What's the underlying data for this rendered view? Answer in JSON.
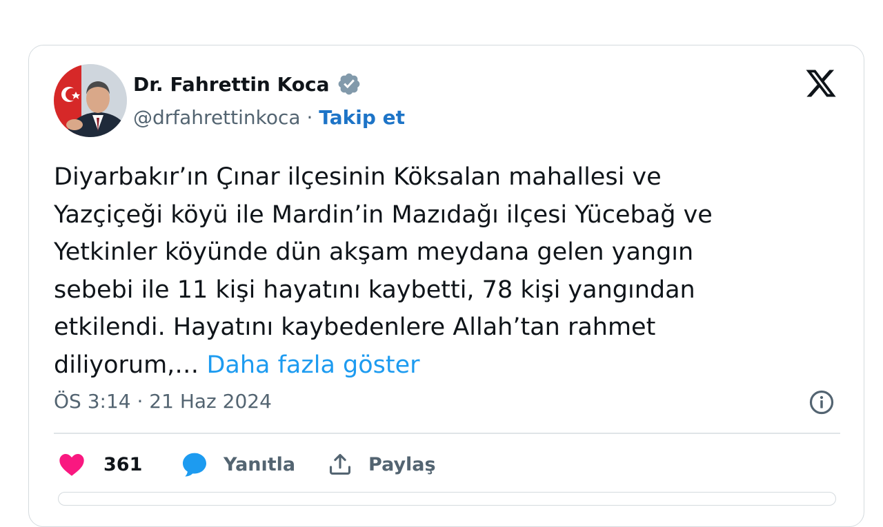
{
  "author": {
    "name": "Dr. Fahrettin Koca",
    "handle": "@drfahrettinkoca",
    "separator": " · ",
    "follow_label": "Takip et"
  },
  "tweet": {
    "lines": [
      "Diyarbakır’ın Çınar ilçesinin Köksalan mahallesi ve",
      "Yazçiçeği köyü ile Mardin’in Mazıdağı ilçesi Yücebağ ve",
      "Yetkinler köyünde dün akşam meydana gelen yangın",
      "sebebi ile 11 kişi hayatını kaybetti, 78 kişi yangından",
      "etkilendi. Hayatını kaybedenlere Allah’tan rahmet",
      "diliyorum,… "
    ],
    "show_more": "Daha fazla göster",
    "timestamp": "ÖS 3:14 · 21 Haz 2024"
  },
  "actions": {
    "like_count": "361",
    "reply_label": "Yanıtla",
    "share_label": "Paylaş"
  },
  "icons": {
    "verified": "verified-badge-icon",
    "platform": "x-logo-icon",
    "info": "info-icon",
    "like": "heart-icon",
    "reply": "speech-bubble-icon",
    "share": "share-upload-icon"
  },
  "colors": {
    "accent": "#1d9bf0",
    "follow": "#1d74c7",
    "like": "#f91880",
    "text": "#0f1419",
    "muted": "#536471",
    "verified": "#829aab"
  }
}
